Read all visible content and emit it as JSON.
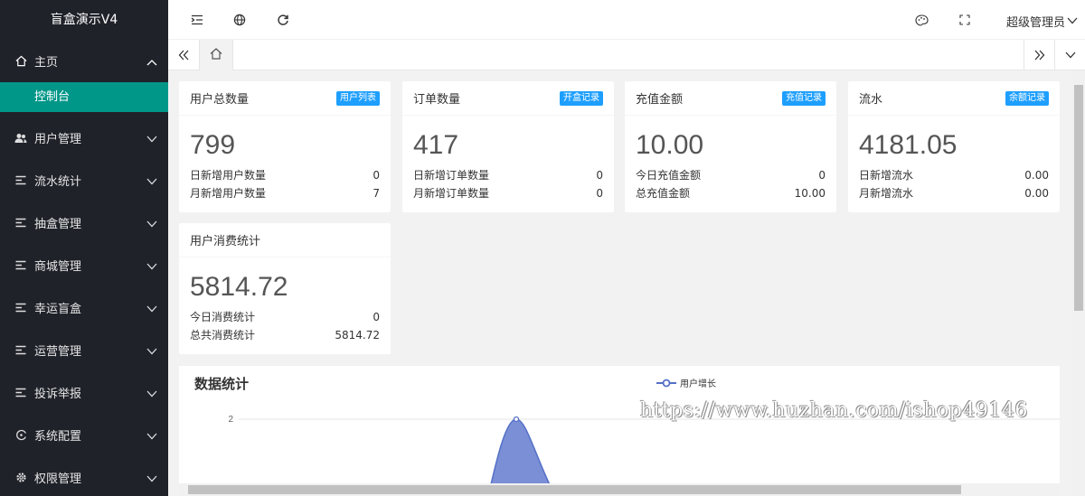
{
  "app": {
    "title": "盲盒演示V4"
  },
  "sidebar": {
    "home": {
      "label": "主页",
      "sub": "控制台"
    },
    "items": [
      {
        "label": "用户管理",
        "icon": "users-icon"
      },
      {
        "label": "流水统计",
        "icon": "list-icon"
      },
      {
        "label": "抽盒管理",
        "icon": "list-icon"
      },
      {
        "label": "商城管理",
        "icon": "list-icon"
      },
      {
        "label": "幸运盲盒",
        "icon": "list-icon"
      },
      {
        "label": "运营管理",
        "icon": "list-icon"
      },
      {
        "label": "投诉举报",
        "icon": "list-icon"
      },
      {
        "label": "系统配置",
        "icon": "settings-icon"
      },
      {
        "label": "权限管理",
        "icon": "gear-icon"
      }
    ]
  },
  "header": {
    "admin_label": "超级管理员"
  },
  "cards": [
    {
      "title": "用户总数量",
      "badge": "用户列表",
      "value": "799",
      "rows": [
        {
          "label": "日新增用户数量",
          "value": "0"
        },
        {
          "label": "月新增用户数量",
          "value": "7"
        }
      ]
    },
    {
      "title": "订单数量",
      "badge": "开盒记录",
      "value": "417",
      "rows": [
        {
          "label": "日新增订单数量",
          "value": "0"
        },
        {
          "label": "月新增订单数量",
          "value": "0"
        }
      ]
    },
    {
      "title": "充值金额",
      "badge": "充值记录",
      "value": "10.00",
      "rows": [
        {
          "label": "今日充值金额",
          "value": "0"
        },
        {
          "label": "总充值金额",
          "value": "10.00"
        }
      ]
    },
    {
      "title": "流水",
      "badge": "余额记录",
      "value": "4181.05",
      "rows": [
        {
          "label": "日新增流水",
          "value": "0.00"
        },
        {
          "label": "月新增流水",
          "value": "0.00"
        }
      ]
    },
    {
      "title": "用户消费统计",
      "badge": "",
      "value": "5814.72",
      "rows": [
        {
          "label": "今日消费统计",
          "value": "0"
        },
        {
          "label": "总共消费统计",
          "value": "5814.72"
        }
      ]
    }
  ],
  "stats": {
    "title": "数据统计",
    "chart_data": {
      "type": "area",
      "series": [
        {
          "name": "用户增长",
          "color": "#7b8fd6",
          "peak": 2
        }
      ],
      "y_ticks": [
        "2"
      ]
    }
  },
  "watermark": "https://www.huzhan.com/ishop49146"
}
